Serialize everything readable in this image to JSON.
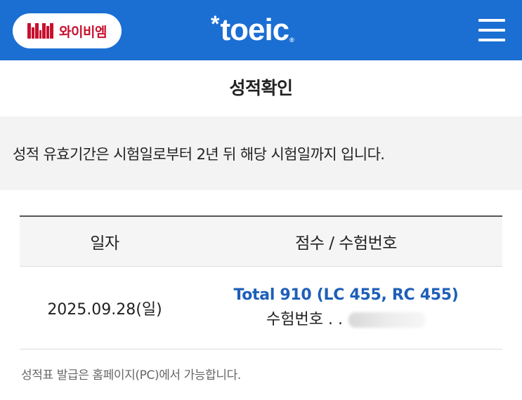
{
  "header": {
    "logo_text": "와이비엠",
    "brand": "toeic",
    "brand_star": "*",
    "brand_reg": "®",
    "accent_color": "#1b6fd3"
  },
  "page": {
    "title": "성적확인",
    "notice": "성적 유효기간은 시험일로부터 2년 뒤 해당 시험일까지 입니다."
  },
  "table": {
    "headers": [
      "일자",
      "점수 / 수험번호"
    ],
    "rows": [
      {
        "date": "2025.09.28(일)",
        "score": "Total 910 (LC 455, RC 455)",
        "exam_label": "수험번호 . ."
      }
    ]
  },
  "footer": {
    "note": "성적표 발급은 홈페이지(PC)에서 가능합니다."
  }
}
